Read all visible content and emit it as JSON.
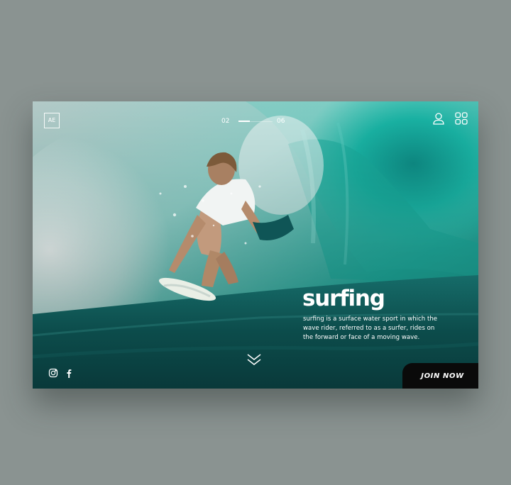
{
  "brand": {
    "logo_text": "AE"
  },
  "pager": {
    "current": "02",
    "total": "06",
    "progress": 0.33
  },
  "header": {
    "user_icon": "user-icon",
    "menu_icon": "grid-menu-icon"
  },
  "hero": {
    "title": "surfing",
    "description": "surfing is a surface water sport in which the wave rider, referred to as a surfer, rides on the forward or face of a moving wave.",
    "scroll_icon": "double-chevron-down-icon"
  },
  "social": [
    {
      "icon": "instagram-icon"
    },
    {
      "icon": "facebook-icon"
    }
  ],
  "cta": {
    "label": "JOIN NOW"
  },
  "colors": {
    "page_background": "#8a9391",
    "wave_teal": "#1fb3a3",
    "deep_water": "#0f5a5a",
    "cta_background": "#0a0a0a",
    "text": "#ffffff"
  }
}
